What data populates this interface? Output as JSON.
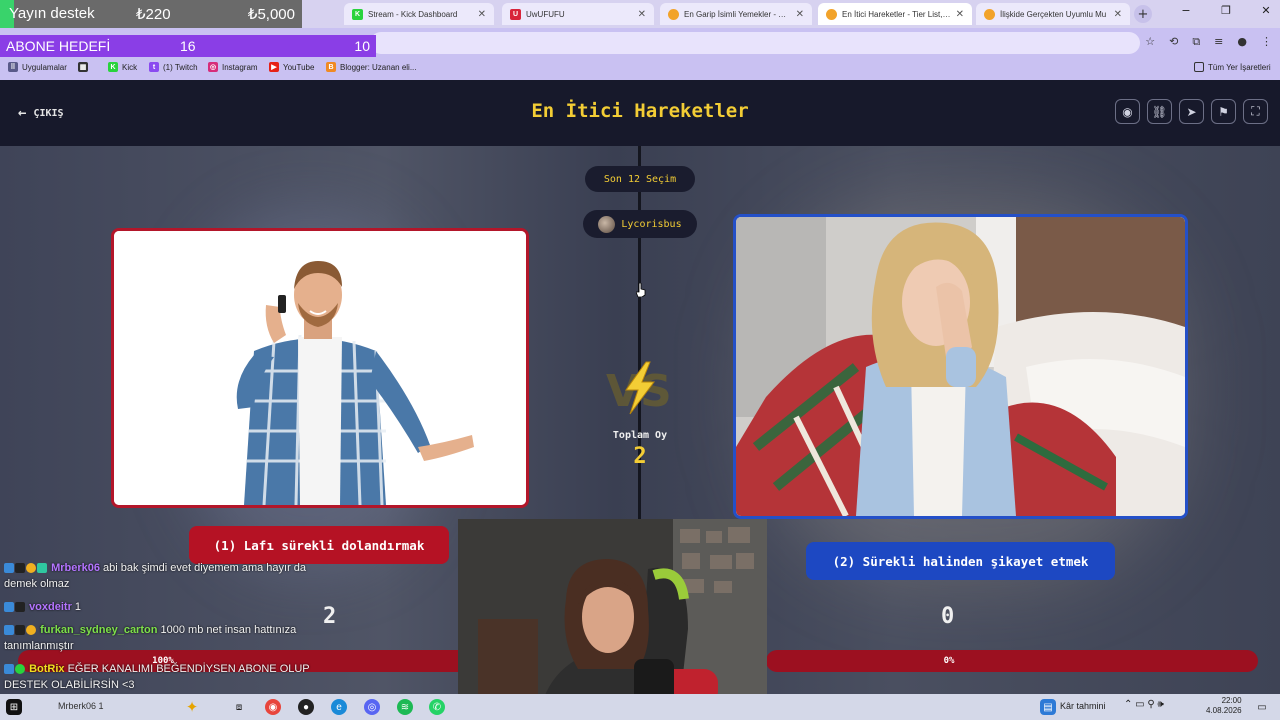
{
  "browser": {
    "tabs": [
      {
        "title": "Stream - Kick Dashboard",
        "icon": "kick-icon",
        "color": "#29d33d",
        "glyph": "K"
      },
      {
        "title": "UwUFUFU",
        "icon": "uwufufu-icon",
        "color": "#d8243a",
        "glyph": "U"
      },
      {
        "title": "En Garip İsimli Yemekler - Tier",
        "icon": "uwufufu-icon",
        "color": "#d8243a",
        "glyph": ""
      },
      {
        "title": "En İtici Hareketler - Tier List, Ki",
        "icon": "uwufufu-icon",
        "color": "#d8243a",
        "glyph": ""
      },
      {
        "title": "İlişkide Gerçekten Uyumlu Mu",
        "icon": "uwufufu-icon",
        "color": "#d8243a",
        "glyph": ""
      }
    ],
    "new_tab": "+",
    "window_controls": {
      "minimize": "−",
      "maximize": "❐",
      "close": "✕"
    },
    "bookmarks": [
      {
        "label": "Uygulamalar",
        "icon": "apps-icon"
      },
      {
        "label": "",
        "icon": "grid-icon"
      },
      {
        "label": "Kick",
        "icon": "kick-icon"
      },
      {
        "label": "(1) Twitch",
        "icon": "twitch-icon"
      },
      {
        "label": "Instagram",
        "icon": "instagram-icon"
      },
      {
        "label": "YouTube",
        "icon": "youtube-icon"
      },
      {
        "label": "Blogger: Uzanan eli...",
        "icon": "blogger-icon"
      }
    ],
    "bookmarks_all": "Tüm Yer İşaretleri"
  },
  "overlay": {
    "donation": {
      "label": "Yayın destek",
      "current": "₺220",
      "goal": "₺5,000"
    },
    "sub_goal": {
      "label": "ABONE HEDEFİ",
      "current": "16",
      "goal": "10"
    }
  },
  "header": {
    "back_label": "ÇIKIŞ",
    "title": "En İtici Hareketler"
  },
  "selection": {
    "recent_label": "Son 12 Seçim",
    "voter": "Lycorisbus",
    "total_label": "Toplam Oy",
    "total_votes": "2"
  },
  "options": {
    "left": {
      "label": "(1) Lafı sürekli dolandırmak",
      "votes": "2",
      "percent_label": "100%",
      "percent": 100,
      "color": "#b51224"
    },
    "right": {
      "label": "(2) Sürekli halinden şikayet etmek",
      "votes": "0",
      "percent_label": "0%",
      "percent": 0,
      "color": "#1d48c2"
    }
  },
  "chat": [
    {
      "user": "Mrberk06",
      "text": "abi bak şimdi evet diyemem ama hayır da demek olmaz",
      "color": "#b474ff"
    },
    {
      "user": "voxdeitr",
      "text": "1",
      "color": "#b474ff"
    },
    {
      "user": "furkan_sydney_carton",
      "text": "1000 mb net insan hattınıza tanımlanmıştır",
      "color": "#7ee04a"
    },
    {
      "user": "BotRix",
      "text": "EĞER KANALIMI BEĞENDİYSEN ABONE OLUP DESTEK OLABİLİRSİN <3",
      "color": "#f0e020"
    }
  ],
  "taskbar": {
    "search_text": "Mrberk06 1",
    "weather": "Kâr tahmini",
    "time": "22:00",
    "date": "4.08.2026"
  }
}
